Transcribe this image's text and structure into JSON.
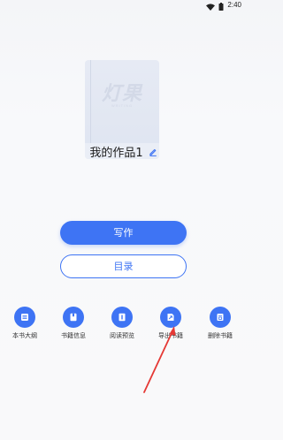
{
  "status_bar": {
    "time": "2:40",
    "icons": [
      "wifi-icon",
      "battery-icon"
    ]
  },
  "book": {
    "cover_watermark_title": "灯果",
    "cover_watermark_sub": "WRITING",
    "title": "我的作品1",
    "edit_icon": "pencil-icon"
  },
  "buttons": {
    "write_label": "写作",
    "catalog_label": "目录"
  },
  "actions": [
    {
      "label": "本书大纲",
      "icon": "list-icon"
    },
    {
      "label": "书籍信息",
      "icon": "bookmark-icon"
    },
    {
      "label": "阅读预览",
      "icon": "book-preview-icon"
    },
    {
      "label": "导出书籍",
      "icon": "export-icon"
    },
    {
      "label": "删除书籍",
      "icon": "delete-icon"
    }
  ],
  "colors": {
    "accent": "#3e74f4",
    "annotation_arrow": "#e53935"
  }
}
